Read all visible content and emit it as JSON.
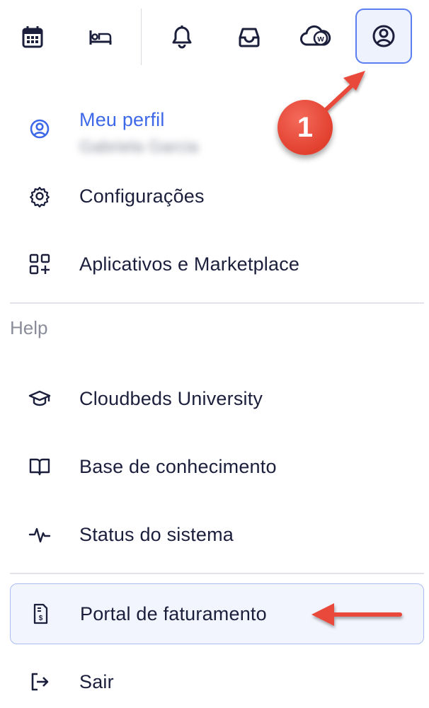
{
  "toolbar": {
    "buttons": [
      {
        "name": "calendar-icon"
      },
      {
        "name": "bed-icon"
      },
      {
        "name": "bell-icon"
      },
      {
        "name": "inbox-icon"
      },
      {
        "name": "whistle-cloud-icon",
        "badge": "w"
      },
      {
        "name": "user-circle-icon",
        "active": true
      }
    ]
  },
  "menu": {
    "profile": {
      "label": "Meu perfil",
      "subtitle": "Gabriela Garcia"
    },
    "settings": {
      "label": "Configurações"
    },
    "apps": {
      "label": "Aplicativos e Marketplace"
    },
    "help_title": "Help",
    "university": {
      "label": "Cloudbeds University"
    },
    "knowledge": {
      "label": "Base de conhecimento"
    },
    "status": {
      "label": "Status do sistema"
    },
    "billing": {
      "label": "Portal de faturamento"
    },
    "logout": {
      "label": "Sair"
    }
  },
  "annotations": {
    "step_number": "1",
    "colors": {
      "callout": "#e2402f",
      "arrow": "#e8483a",
      "accent": "#3d68e8"
    }
  }
}
